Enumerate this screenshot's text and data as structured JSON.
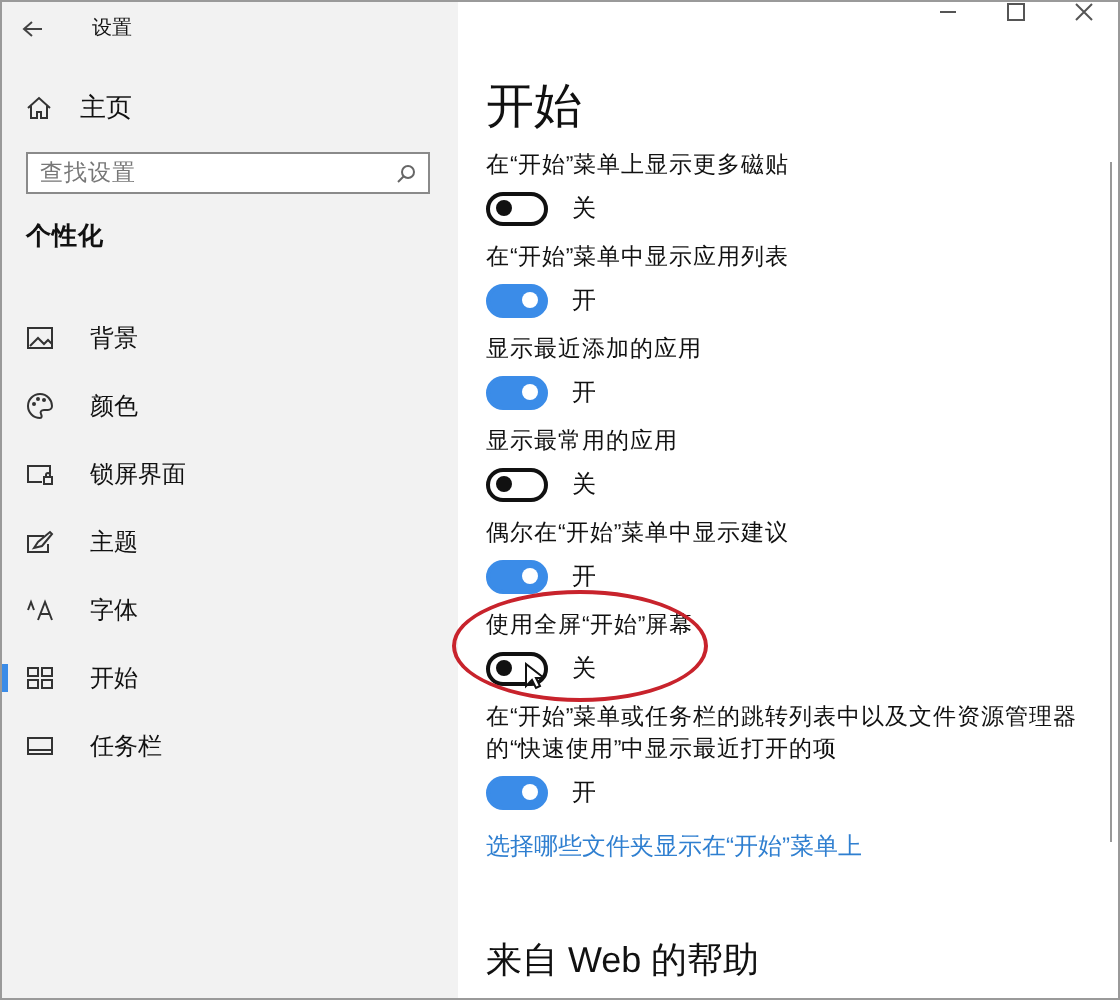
{
  "window": {
    "title": "设置"
  },
  "sidebar": {
    "home": "主页",
    "search": {
      "placeholder": "查找设置"
    },
    "section": "个性化",
    "items": [
      {
        "label": "背景",
        "selected": false
      },
      {
        "label": "颜色",
        "selected": false
      },
      {
        "label": "锁屏界面",
        "selected": false
      },
      {
        "label": "主题",
        "selected": false
      },
      {
        "label": "字体",
        "selected": false
      },
      {
        "label": "开始",
        "selected": true
      },
      {
        "label": "任务栏",
        "selected": false
      }
    ]
  },
  "page": {
    "title": "开始",
    "settings": [
      {
        "label": "在“开始”菜单上显示更多磁贴",
        "on": false,
        "state": "关",
        "highlighted": false
      },
      {
        "label": "在“开始”菜单中显示应用列表",
        "on": true,
        "state": "开",
        "highlighted": false
      },
      {
        "label": "显示最近添加的应用",
        "on": true,
        "state": "开",
        "highlighted": false
      },
      {
        "label": "显示最常用的应用",
        "on": false,
        "state": "关",
        "highlighted": false
      },
      {
        "label": "偶尔在“开始”菜单中显示建议",
        "on": true,
        "state": "开",
        "highlighted": false
      },
      {
        "label": "使用全屏“开始”屏幕",
        "on": false,
        "state": "关",
        "highlighted": true
      },
      {
        "label": "在“开始”菜单或任务栏的跳转列表中以及文件资源管理器的“快速使用”中显示最近打开的项",
        "on": true,
        "state": "开",
        "highlighted": false
      }
    ],
    "link": "选择哪些文件夹显示在“开始”菜单上",
    "help_title": "来自 Web 的帮助"
  }
}
